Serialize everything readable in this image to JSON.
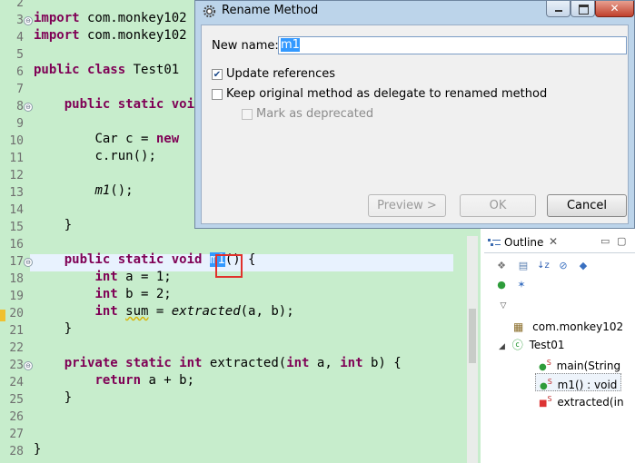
{
  "dialog": {
    "title": "Rename Method",
    "new_name_label": "New name:",
    "new_name_value": "m1",
    "update_references_label": "Update references",
    "update_references_checked": true,
    "keep_original_label": "Keep original method as delegate to renamed method",
    "keep_original_checked": false,
    "mark_deprecated_label": "Mark as deprecated",
    "mark_deprecated_checked": false,
    "preview_label": "Preview >",
    "ok_label": "OK",
    "cancel_label": "Cancel"
  },
  "editor": {
    "line_numbers": [
      "2",
      "3",
      "4",
      "5",
      "6",
      "7",
      "8",
      "9",
      "10",
      "11",
      "12",
      "13",
      "14",
      "15",
      "16",
      "17",
      "18",
      "19",
      "20",
      "21",
      "22",
      "23",
      "24",
      "25",
      "26",
      "27",
      "28"
    ],
    "lines": {
      "l3": [
        "import",
        " com.monkey102"
      ],
      "l4": [
        "import",
        " com.monkey102"
      ],
      "l6": [
        "public",
        " ",
        "class",
        " Test01"
      ],
      "l8": [
        "public",
        " ",
        "static",
        " void"
      ],
      "l10": [
        "Car c = ",
        "new"
      ],
      "l11": "c.run();",
      "l13": [
        "m1",
        "();"
      ],
      "l15": "}",
      "l17": [
        "public",
        " ",
        "static",
        " ",
        "void",
        " ",
        "m1",
        "() {"
      ],
      "l18": [
        "int",
        " a = 1;"
      ],
      "l19": [
        "int",
        " b = 2;"
      ],
      "l20": [
        "int",
        " ",
        "sum",
        " = ",
        "extracted",
        "(a, b);"
      ],
      "l21": "}",
      "l23": [
        "private",
        " ",
        "static",
        " ",
        "int",
        " extracted(",
        "int",
        " a, ",
        "int",
        " b) {"
      ],
      "l24": [
        "return",
        " a + b;"
      ],
      "l25": "}",
      "l28": "}"
    }
  },
  "outline": {
    "tab_label": "Outline",
    "items": [
      {
        "label": "com.monkey102"
      },
      {
        "label": "Test01"
      },
      {
        "label": "main(String"
      },
      {
        "label": "m1() : void"
      },
      {
        "label": "extracted(in"
      }
    ]
  },
  "colors": {
    "editor_bg": "#c7edcc",
    "keyword": "#7f0055",
    "selection": "#3399ff",
    "highlight_box": "#e0312c",
    "dialog_frame": "#bcd4ea"
  }
}
